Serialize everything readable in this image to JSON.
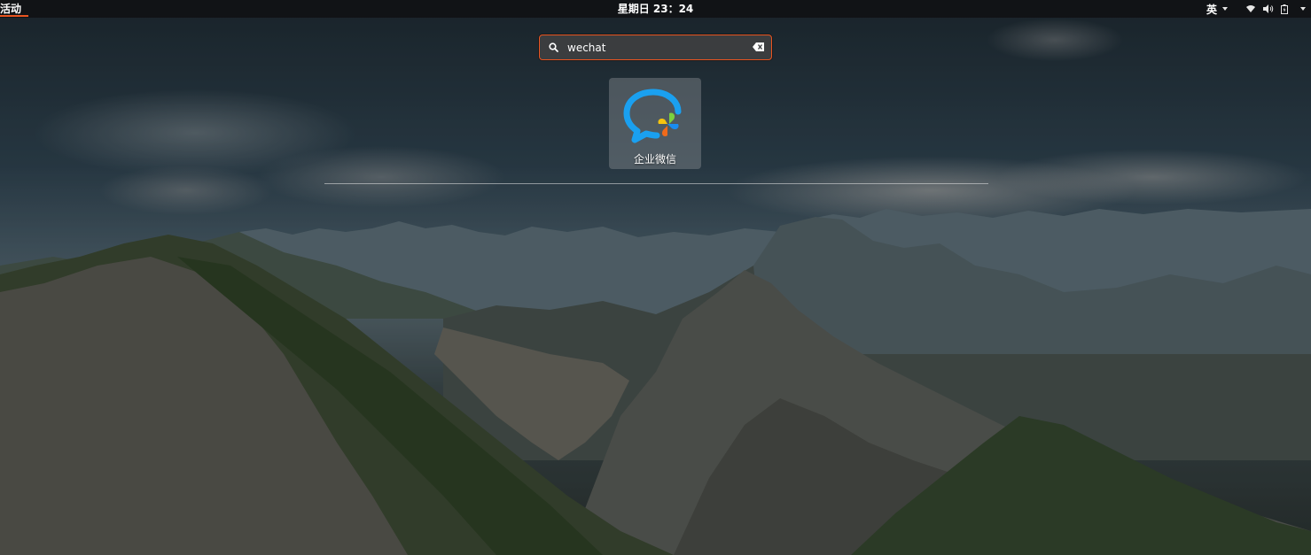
{
  "topbar": {
    "activities_label": "活动",
    "clock_text": "星期日 23：24",
    "input_method_label": "英",
    "status_icons": [
      "wifi-icon",
      "volume-icon",
      "battery-icon",
      "system-menu-caret-icon"
    ]
  },
  "search": {
    "value": "wechat",
    "icon": "search-icon",
    "clear_icon": "clear-text-icon"
  },
  "results": [
    {
      "label": "企业微信",
      "icon": "wecom-app-icon"
    }
  ],
  "colors": {
    "accent": "#e95420",
    "topbar_bg": "#111316",
    "tile_bg": "#8c9196"
  }
}
